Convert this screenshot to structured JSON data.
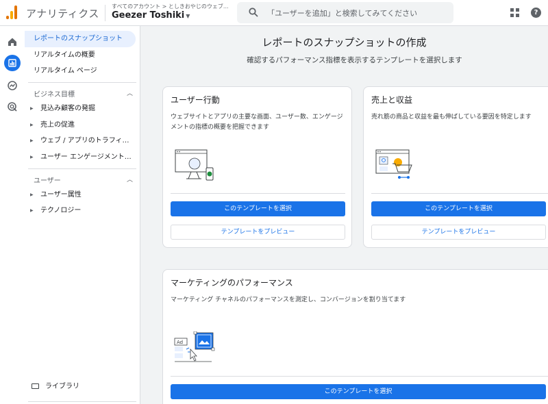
{
  "header": {
    "app_title": "アナリティクス",
    "account_path": "すべてのアカウント > としきおやじのウェブ...",
    "account_name": "Geezer Toshiki",
    "search_placeholder": "「ユーザーを追加」と検索してみてください",
    "apps_icon": "apps-grid-icon",
    "help_icon": "help-icon",
    "help_glyph": "?"
  },
  "rail": {
    "items": [
      {
        "icon": "home-icon"
      },
      {
        "icon": "reports-icon"
      },
      {
        "icon": "explore-icon"
      },
      {
        "icon": "advertising-icon"
      }
    ]
  },
  "sidenav": {
    "top_items": [
      "レポートのスナップショット",
      "リアルタイムの概要",
      "リアルタイム ページ"
    ],
    "sections": [
      {
        "label": "ビジネス目標",
        "items": [
          "見込み顧客の発掘",
          "売上の促進",
          "ウェブ / アプリのトラフィック...",
          "ユーザー エンゲージメントと..."
        ]
      },
      {
        "label": "ユーザー",
        "items": [
          "ユーザー属性",
          "テクノロジー"
        ]
      }
    ],
    "library": "ライブラリ"
  },
  "main": {
    "title": "レポートのスナップショットの作成",
    "subtitle": "確認するパフォーマンス指標を表示するテンプレートを選択します",
    "cards": [
      {
        "title": "ユーザー行動",
        "description": "ウェブサイトとアプリの主要な画面、ユーザー数、エンゲージメントの指標の概要を把握できます",
        "select_label": "このテンプレートを選択",
        "preview_label": "テンプレートをプレビュー"
      },
      {
        "title": "売上と収益",
        "description": "売れ筋の商品と収益を最も伸ばしている要因を特定します",
        "select_label": "このテンプレートを選択",
        "preview_label": "テンプレートをプレビュー"
      },
      {
        "title": "マーケティングのパフォーマンス",
        "description": "マーケティング チャネルのパフォーマンスを測定し、コンバージョンを割り当てます",
        "illustration_label": "Ad",
        "select_label": "このテンプレートを選択"
      }
    ]
  },
  "colors": {
    "accent": "#1a73e8",
    "nav_active_bg": "#e8f0fe",
    "logo_orange": "#e37400",
    "logo_yellow": "#f9ab00"
  }
}
